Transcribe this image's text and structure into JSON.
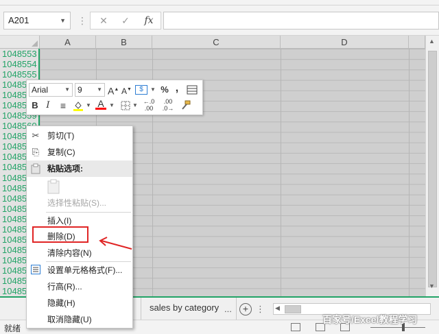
{
  "formula_bar": {
    "name_box": "A201",
    "separator": "⋮",
    "cancel_glyph": "✕",
    "enter_glyph": "✓",
    "fx_glyph": "fx",
    "formula": ""
  },
  "grid": {
    "columns": [
      "A",
      "B",
      "C",
      "D"
    ],
    "row_labels": [
      "1048553",
      "1048554",
      "1048555",
      "10485",
      "10485",
      "10485",
      "1048559",
      "1048560",
      "10485",
      "10485",
      "10485",
      "10485",
      "10485",
      "10485",
      "10485",
      "10485",
      "10485",
      "10485",
      "10485",
      "10485",
      "10485",
      "10485",
      "10485",
      "10485"
    ]
  },
  "mini_toolbar": {
    "font_name": "Arial",
    "font_size": "9",
    "increase_font": "A",
    "decrease_font": "A",
    "percent": "%",
    "comma": ",",
    "bold": "B",
    "italic": "I",
    "font_color_glyph": "A",
    "decimal_increase": ".00",
    "decimal_decrease": ".0",
    "fill_color": "#ffff00",
    "font_color": "#ff0000"
  },
  "context_menu": {
    "items": [
      {
        "label": "剪切(T)",
        "icon": "scissors-icon",
        "glyph": "✂",
        "enabled": true
      },
      {
        "label": "复制(C)",
        "icon": "copy-icon",
        "glyph": "⎘",
        "enabled": true
      },
      {
        "label": "粘贴选项:",
        "icon": "paste-icon",
        "glyph": "📋",
        "enabled": true,
        "header": true
      },
      {
        "label": "选择性粘贴(S)...",
        "icon": "",
        "glyph": "",
        "enabled": false
      },
      {
        "label": "插入(I)",
        "icon": "",
        "glyph": "",
        "enabled": true
      },
      {
        "label": "删除(D)",
        "icon": "",
        "glyph": "",
        "enabled": true
      },
      {
        "label": "清除内容(N)",
        "icon": "",
        "glyph": "",
        "enabled": true
      },
      {
        "label": "设置单元格格式(F)...",
        "icon": "format-cells-icon",
        "glyph": "☰",
        "enabled": true
      },
      {
        "label": "行高(R)...",
        "icon": "",
        "glyph": "",
        "enabled": true
      },
      {
        "label": "隐藏(H)",
        "icon": "",
        "glyph": "",
        "enabled": true
      },
      {
        "label": "取消隐藏(U)",
        "icon": "",
        "glyph": "",
        "enabled": true
      }
    ],
    "highlight_color": "#e02424"
  },
  "sheets": {
    "active_tab": "sales by category",
    "more": "...",
    "add_glyph": "+"
  },
  "status_bar": {
    "status": "就绪"
  },
  "watermark": "百家号/Excel教程学习",
  "colors": {
    "accent_green": "#21a366",
    "grid_fill": "#cfcfcf"
  }
}
